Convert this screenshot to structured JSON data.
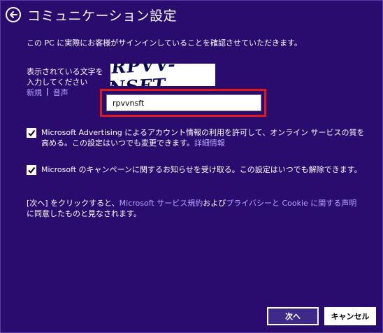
{
  "header": {
    "title": "コミュニケーション設定"
  },
  "intro": "この PC に実際にお客様がサインインしていることを確認させていただきます。",
  "captcha": {
    "label": "表示されている文字を入力してください",
    "new_link": "新規",
    "separator": "|",
    "audio_link": "音声",
    "image_text": "RPVV-NSFT",
    "input_value": "rpvvnsft"
  },
  "options": [
    {
      "checked": true,
      "text": "Microsoft Advertising によるアカウント情報の利用を許可して、オンライン サービスの質を高める。この設定はいつでも変更できます。",
      "link": "詳細情報"
    },
    {
      "checked": true,
      "text": "Microsoft のキャンペーンに関するお知らせを受け取る。この設定はいつでも解除できます。"
    }
  ],
  "terms": {
    "part1": "[次へ] をクリックすると、",
    "link1": "Microsoft サービス規約",
    "part2": "および",
    "link2": "プライバシーと Cookie に関する声明",
    "part3": "に同意したものと見なされます。"
  },
  "buttons": {
    "next": "次へ",
    "cancel": "キャンセル"
  },
  "colors": {
    "background": "#2a0b6e",
    "link": "#b7a5ff",
    "highlight": "#e01a1a"
  }
}
